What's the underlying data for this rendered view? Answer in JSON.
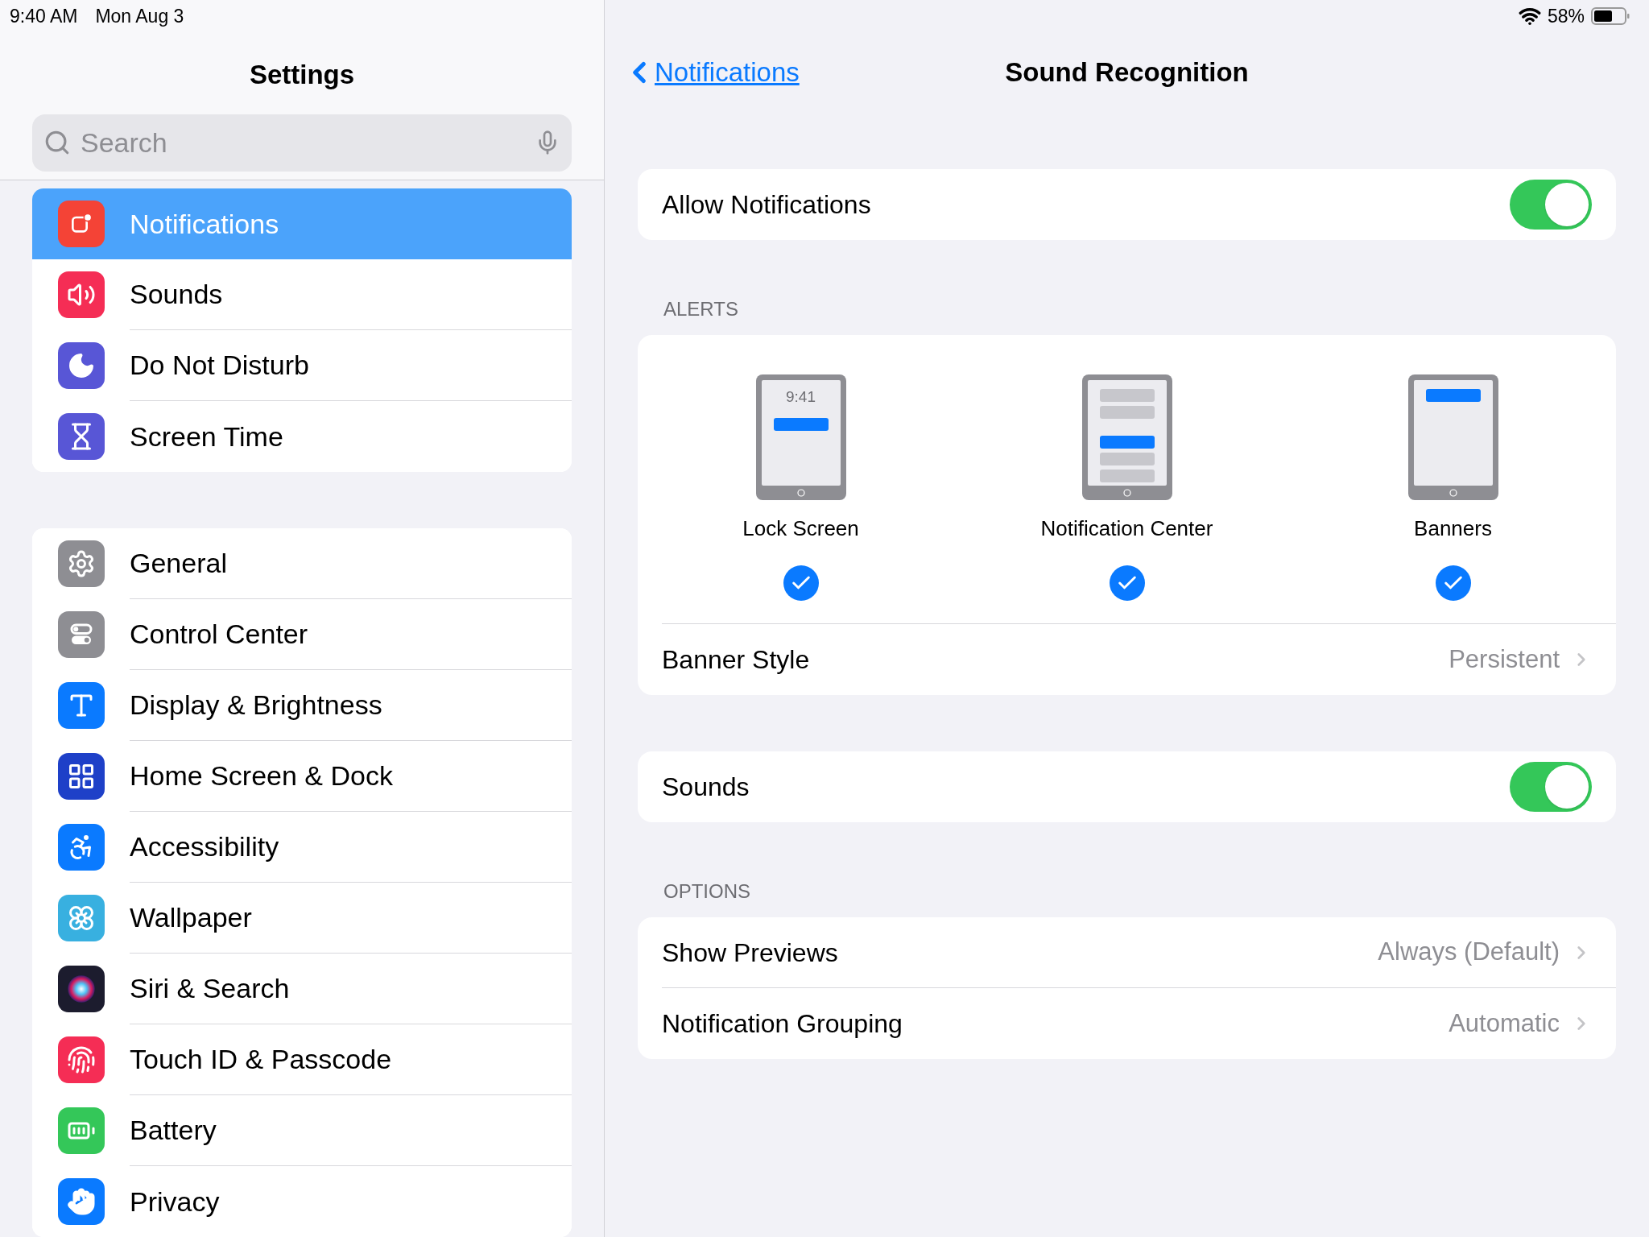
{
  "status_bar": {
    "time": "9:40 AM",
    "date": "Mon Aug 3",
    "battery": "58%"
  },
  "sidebar": {
    "title": "Settings",
    "search": {
      "placeholder": "Search"
    },
    "groups": [
      [
        {
          "label": "Notifications",
          "selected": true
        },
        {
          "label": "Sounds",
          "selected": false
        },
        {
          "label": "Do Not Disturb",
          "selected": false
        },
        {
          "label": "Screen Time",
          "selected": false
        }
      ],
      [
        {
          "label": "General",
          "selected": false
        },
        {
          "label": "Control Center",
          "selected": false
        },
        {
          "label": "Display & Brightness",
          "selected": false
        },
        {
          "label": "Home Screen & Dock",
          "selected": false
        },
        {
          "label": "Accessibility",
          "selected": false
        },
        {
          "label": "Wallpaper",
          "selected": false
        },
        {
          "label": "Siri & Search",
          "selected": false
        },
        {
          "label": "Touch ID & Passcode",
          "selected": false
        },
        {
          "label": "Battery",
          "selected": false
        },
        {
          "label": "Privacy",
          "selected": false
        }
      ]
    ]
  },
  "nav": {
    "back": "Notifications",
    "title": "Sound Recognition"
  },
  "allow_notifications": {
    "label": "Allow Notifications",
    "on": true
  },
  "alerts": {
    "header": "ALERTS",
    "options": [
      {
        "kind": "lock_screen",
        "screen_time": "9:41",
        "label": "Lock Screen",
        "checked": true
      },
      {
        "kind": "notification_center",
        "label": "Notification Center",
        "checked": true
      },
      {
        "kind": "banners",
        "label": "Banners",
        "checked": true
      }
    ],
    "banner_style": {
      "label": "Banner Style",
      "value": "Persistent"
    }
  },
  "sounds": {
    "label": "Sounds",
    "on": true
  },
  "options": {
    "header": "OPTIONS",
    "rows": [
      {
        "label": "Show Previews",
        "value": "Always (Default)"
      },
      {
        "label": "Notification Grouping",
        "value": "Automatic"
      }
    ]
  }
}
